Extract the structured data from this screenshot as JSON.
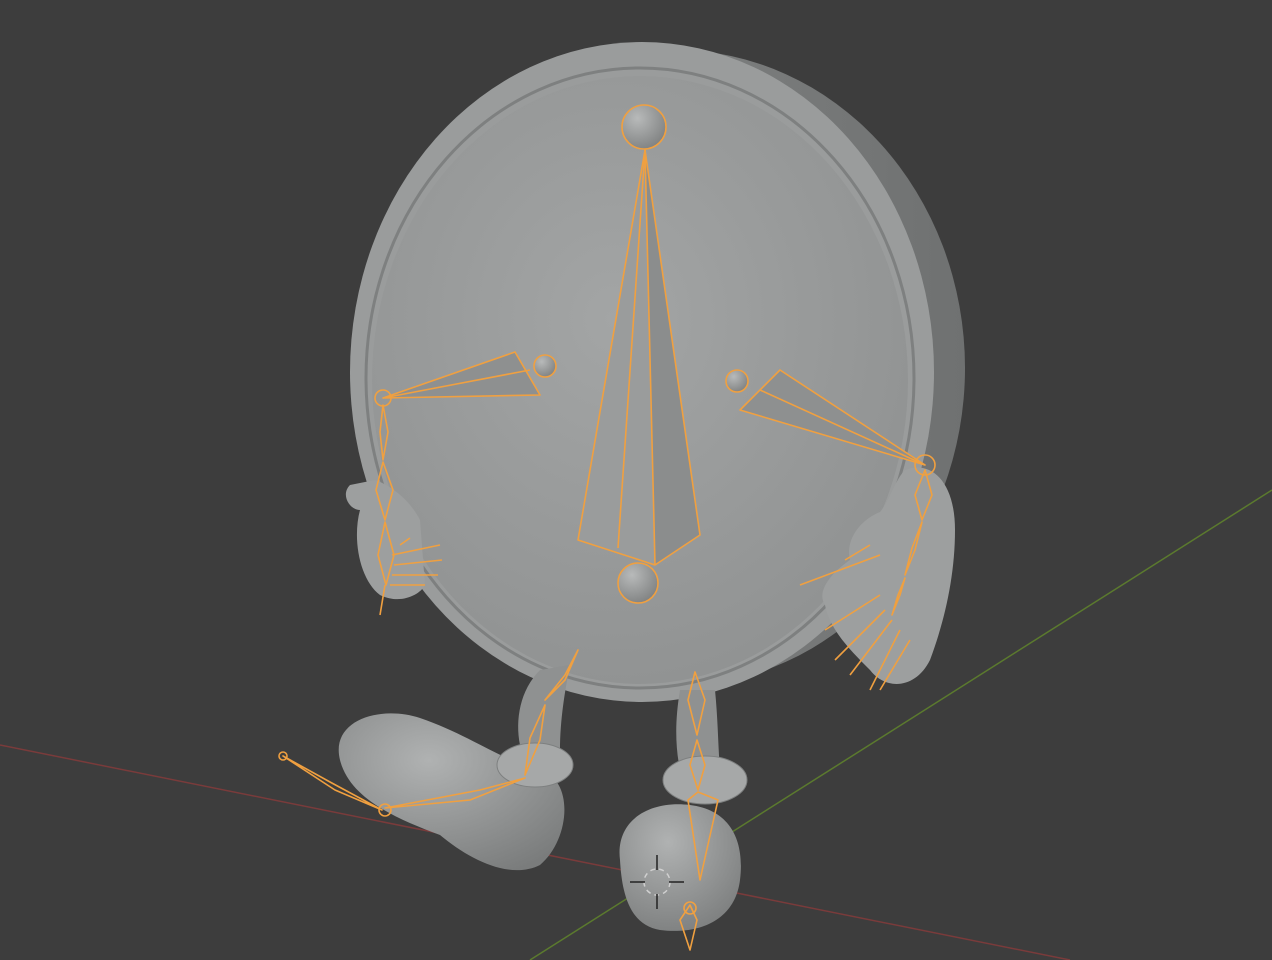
{
  "app": "3D viewport",
  "viewport": {
    "background": "#3d3d3d",
    "mode": "pose-edit",
    "x_axis_color": "#7a3b3b",
    "y_axis_color": "#5b7a2e",
    "selection_color": "#f0a040",
    "mesh_color": "#9a9c9c"
  },
  "scene": {
    "object": "clock-character",
    "armature": "rig",
    "bones": [
      "hour-hand-bone",
      "minute-hand-bone",
      "minute-hand-bone-right",
      "left-arm-bone",
      "right-arm-bone",
      "left-hand-finger-bones",
      "right-hand-finger-bones",
      "left-leg-bone",
      "right-leg-bone",
      "left-foot-bone",
      "right-foot-bone"
    ],
    "3d_cursor": "3d-cursor-icon"
  }
}
